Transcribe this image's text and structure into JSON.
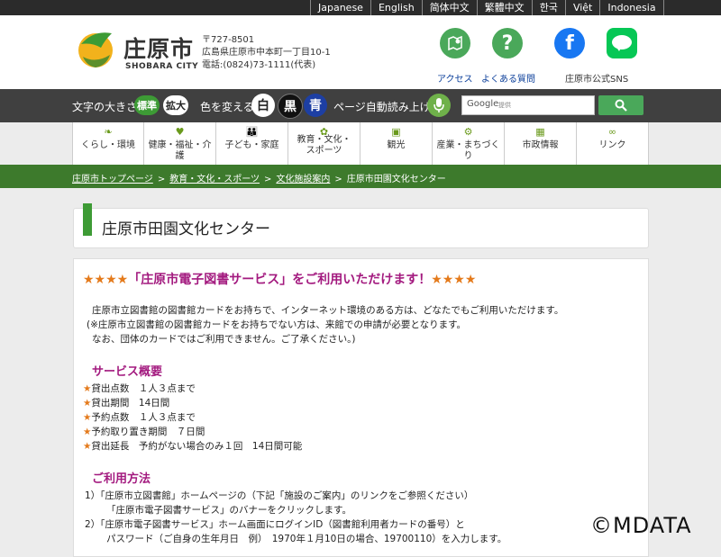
{
  "languages": [
    "Japanese",
    "English",
    "简体中文",
    "繁體中文",
    "한국",
    "Việt",
    "Indonesia"
  ],
  "header": {
    "logo_jp": "庄原市",
    "logo_en": "SHOBARA CITY",
    "postal": "〒727-8501",
    "address": "広島県庄原市中本町一丁目10-1",
    "phone": "電話:(0824)73-1111(代表)",
    "access_label": "アクセス",
    "faq_label": "よくある質問",
    "sns_label": "庄原市公式SNS"
  },
  "toolbar": {
    "font_size_label": "文字の大きさ",
    "standard": "標準",
    "large": "拡大",
    "color_label": "色を変える",
    "white": "白",
    "black": "黒",
    "blue": "青",
    "read_aloud": "ページ自動読み上げ",
    "search_brand": "Google",
    "search_placeholder": "提供"
  },
  "nav": [
    {
      "label": "くらし・環境"
    },
    {
      "label": "健康・福祉・介護"
    },
    {
      "label": "子ども・家庭"
    },
    {
      "label": "教育・文化・スポーツ"
    },
    {
      "label": "観光"
    },
    {
      "label": "産業・まちづくり"
    },
    {
      "label": "市政情報"
    },
    {
      "label": "リンク"
    }
  ],
  "breadcrumb": [
    "庄原市トップページ",
    "教育・文化・スポーツ",
    "文化施設案内",
    "庄原市田園文化センター"
  ],
  "page_title": "庄原市田園文化センター",
  "content": {
    "stars": "★★★★",
    "headline": "「庄原市電子図書サービス」をご利用いただけます！",
    "intro": [
      "庄原市立図書館の図書館カードをお持ちで、インターネット環境のある方は、どなたでもご利用いただけます。",
      "(※庄原市立図書館の図書館カードをお持ちでない方は、来館での申請が必要となります。",
      "なお、団体のカードではご利用できません。ご了承ください。)"
    ],
    "overview_title": "サービス概要",
    "overview": [
      "貸出点数　１人３点まで",
      "貸出期間　14日間",
      "予約点数　１人３点まで",
      "予約取り置き期間　７日間",
      "貸出延長　予約がない場合のみ１回　14日間可能"
    ],
    "usage_title": "ご利用方法",
    "usage": [
      "1）「庄原市立図書館」ホームページの（下記「施設のご案内」のリンクをご参照ください）",
      "「庄原市電子図書サービス」のバナーをクリックします。",
      "2）「庄原市電子図書サービス」ホーム画面にログインID（図書館利用者カードの番号）と",
      "パスワード（ご自身の生年月日　例）　1970年１月10日の場合、19700110）を入力します。"
    ],
    "star_mark": "★"
  },
  "watermark": "©MDATA",
  "colors": {
    "accent_green": "#3d7a2c",
    "headline": "#a31a7f",
    "star": "#e47a1b"
  }
}
